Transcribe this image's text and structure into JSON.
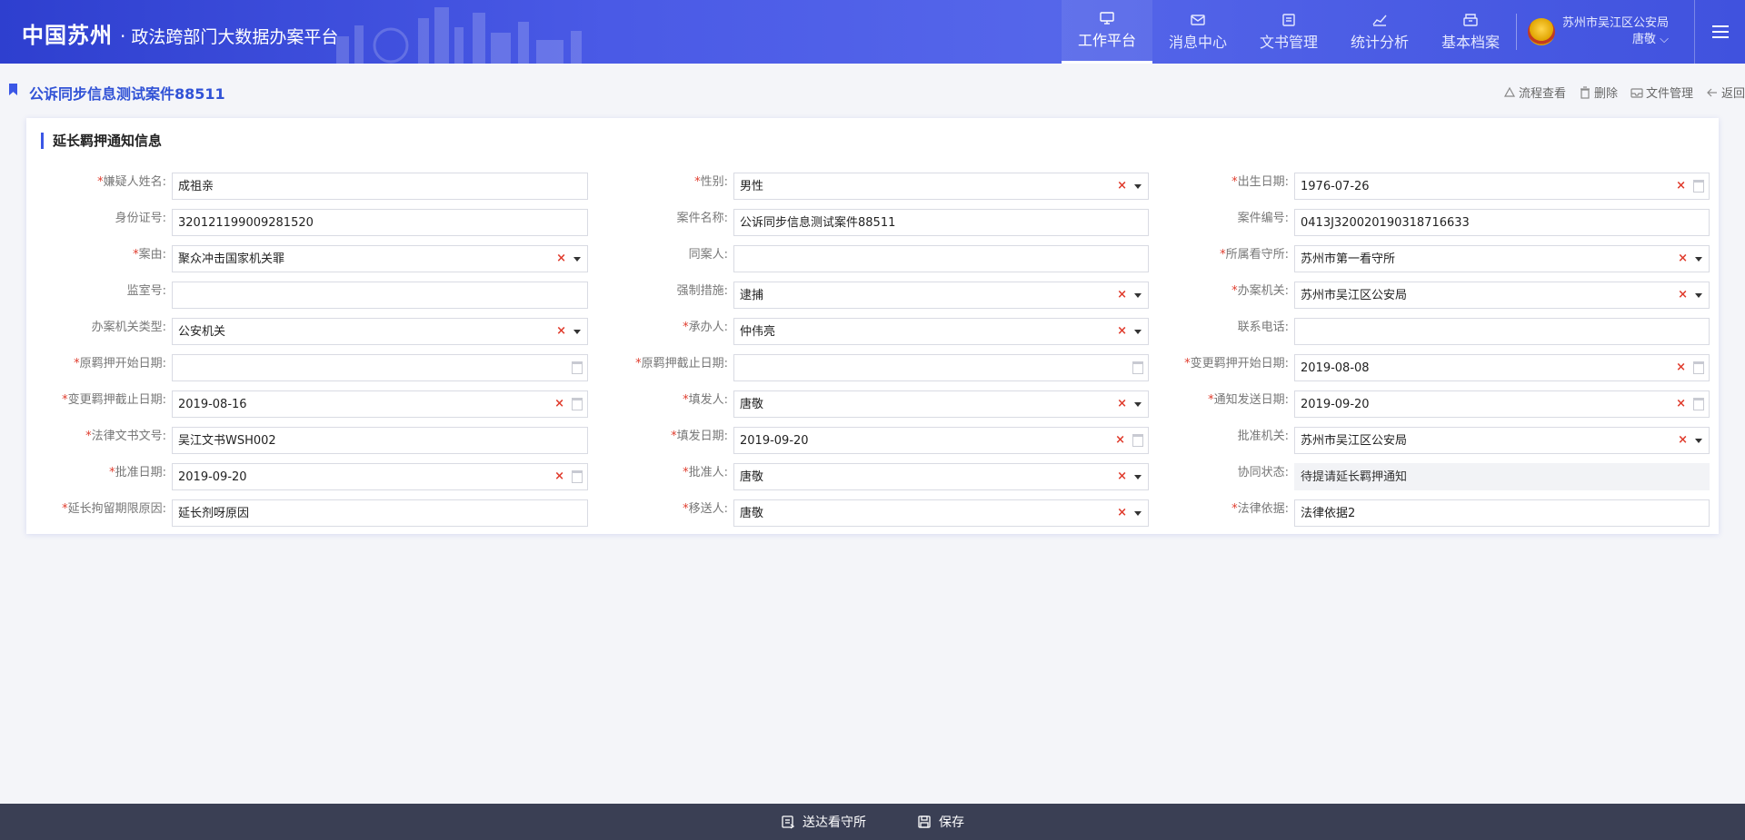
{
  "app": {
    "brand_main": "中国苏州",
    "brand_dot": "·",
    "brand_sub": "政法跨部门大数据办案平台"
  },
  "nav": {
    "items": [
      {
        "label": "工作平台",
        "icon": "monitor-icon",
        "active": true
      },
      {
        "label": "消息中心",
        "icon": "mail-icon",
        "active": false
      },
      {
        "label": "文书管理",
        "icon": "document-icon",
        "active": false
      },
      {
        "label": "统计分析",
        "icon": "chart-icon",
        "active": false
      },
      {
        "label": "基本档案",
        "icon": "archive-icon",
        "active": false
      }
    ]
  },
  "user": {
    "org": "苏州市吴江区公安局",
    "name": "唐敬 ⌵"
  },
  "page": {
    "case_title": "公诉同步信息测试案件88511",
    "actions": {
      "process": "流程查看",
      "delete": "删除",
      "files": "文件管理",
      "back": "返回"
    }
  },
  "form": {
    "section_title": "延长羁押通知信息",
    "fields": {
      "suspect_name": {
        "label": "嫌疑人姓名:",
        "value": "成祖亲",
        "required": true
      },
      "gender": {
        "label": "性别:",
        "value": "男性",
        "required": true
      },
      "birth_date": {
        "label": "出生日期:",
        "value": "1976-07-26",
        "required": true
      },
      "id_number": {
        "label": "身份证号:",
        "value": "320121199009281520",
        "required": false
      },
      "case_name": {
        "label": "案件名称:",
        "value": "公诉同步信息测试案件88511",
        "required": false
      },
      "case_number": {
        "label": "案件编号:",
        "value": "0413J320020190318716633",
        "required": false
      },
      "cause": {
        "label": "案由:",
        "value": "聚众冲击国家机关罪",
        "required": true
      },
      "co_defendant": {
        "label": "同案人:",
        "value": "",
        "required": false
      },
      "detention_center": {
        "label": "所属看守所:",
        "value": "苏州市第一看守所",
        "required": true
      },
      "cell_number": {
        "label": "监室号:",
        "value": "",
        "required": false
      },
      "coercive_measure": {
        "label": "强制措施:",
        "value": "逮捕",
        "required": false
      },
      "handling_org": {
        "label": "办案机关:",
        "value": "苏州市吴江区公安局",
        "required": true
      },
      "handling_org_type": {
        "label": "办案机关类型:",
        "value": "公安机关",
        "required": false
      },
      "handler": {
        "label": "承办人:",
        "value": "仲伟亮",
        "required": true
      },
      "phone": {
        "label": "联系电话:",
        "value": "",
        "required": false
      },
      "orig_start": {
        "label": "原羁押开始日期:",
        "value": "",
        "required": true
      },
      "orig_end": {
        "label": "原羁押截止日期:",
        "value": "",
        "required": true
      },
      "new_start": {
        "label": "变更羁押开始日期:",
        "value": "2019-08-08",
        "required": true
      },
      "new_end": {
        "label": "变更羁押截止日期:",
        "value": "2019-08-16",
        "required": true
      },
      "issuer": {
        "label": "填发人:",
        "value": "唐敬",
        "required": true
      },
      "notify_date": {
        "label": "通知发送日期:",
        "value": "2019-09-20",
        "required": true
      },
      "doc_number": {
        "label": "法律文书文号:",
        "value": "吴江文书WSH002",
        "required": true
      },
      "issue_date": {
        "label": "填发日期:",
        "value": "2019-09-20",
        "required": true
      },
      "approve_org": {
        "label": "批准机关:",
        "value": "苏州市吴江区公安局",
        "required": false
      },
      "approve_date": {
        "label": "批准日期:",
        "value": "2019-09-20",
        "required": true
      },
      "approver": {
        "label": "批准人:",
        "value": "唐敬",
        "required": true
      },
      "sync_status": {
        "label": "协同状态:",
        "value": "待提请延长羁押通知",
        "required": false
      },
      "extend_reason": {
        "label": "延长拘留期限原因:",
        "value": "延长剂呀原因",
        "required": true
      },
      "transferor": {
        "label": "移送人:",
        "value": "唐敬",
        "required": true
      },
      "legal_basis": {
        "label": "法律依据:",
        "value": "法律依据2",
        "required": true
      }
    }
  },
  "footer": {
    "send_label": "送达看守所",
    "save_label": "保存"
  }
}
